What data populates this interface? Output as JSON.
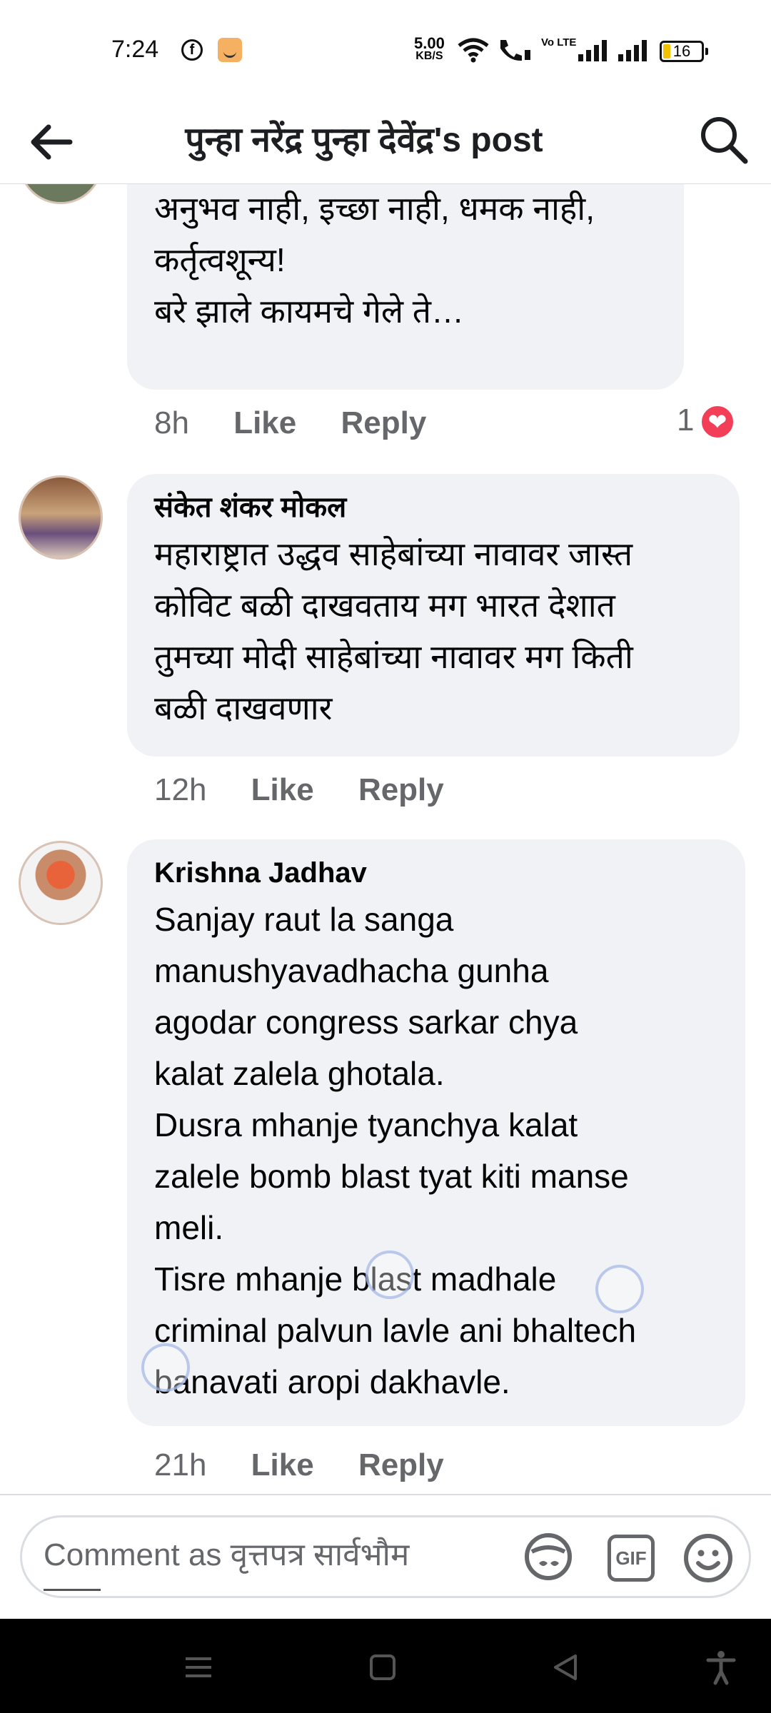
{
  "status_bar": {
    "time": "7:24",
    "net_speed_value": "5.00",
    "net_speed_unit": "KB/S",
    "volte_label": "Vo LTE",
    "battery": "16",
    "icons": [
      "facebook-icon",
      "amazon-icon",
      "wifi-icon",
      "wifi-call-icon",
      "signal-icon",
      "signal-icon",
      "battery-icon"
    ]
  },
  "header": {
    "title": "पुन्हा नरेंद्र पुन्हा देवेंद्र's post",
    "back_icon": "back-arrow-icon",
    "search_icon": "search-icon"
  },
  "comments": [
    {
      "author": "",
      "text": "Kay भयानक होत ते नेतृत्व.. कोडीचा\nअनुभव नाही, इच्छा नाही, धमक नाही,\nकर्तृत्वशून्य!\nबरे झाले कायमचे गेले ते…",
      "time": "8h",
      "like_label": "Like",
      "reply_label": "Reply",
      "reaction_count": "1",
      "reaction_icon": "heart-reaction-icon"
    },
    {
      "author": "संकेत शंकर मोकल",
      "text": "महाराष्ट्रात उद्धव साहेबांच्या नावावर जास्त\nकोविट बळी दाखवताय मग भारत देशात\nतुमच्या मोदी साहेबांच्या नावावर मग किती\nबळी दाखवणार",
      "time": "12h",
      "like_label": "Like",
      "reply_label": "Reply"
    },
    {
      "author": "Krishna Jadhav",
      "text": "Sanjay raut la sanga\nmanushyavadhacha gunha\nagodar congress sarkar chya\nkalat zalela ghotala.\nDusra mhanje tyanchya kalat\nzalele bomb blast tyat kiti manse\nmeli.\nTisre mhanje blast madhale\ncriminal palvun lavle ani bhaltech\nbanavati aropi dakhavle.",
      "time": "21h",
      "like_label": "Like",
      "reply_label": "Reply"
    }
  ],
  "composer": {
    "placeholder": "Comment as वृत्तपत्र सार्वभौम",
    "gif_label": "GIF",
    "icons": [
      "sticker-icon",
      "gif-icon",
      "emoji-icon"
    ]
  },
  "nav_bar": {
    "icons": [
      "menu-icon",
      "home-icon",
      "back-icon",
      "accessibility-icon"
    ]
  },
  "colors": {
    "bubble_bg": "#f0f2f5",
    "action_gray": "#65676b",
    "heart_red": "#f33e58"
  }
}
